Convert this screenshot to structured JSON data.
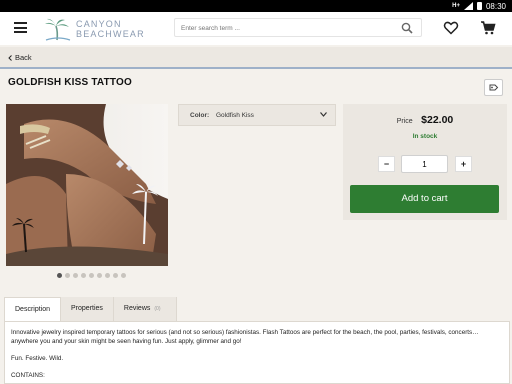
{
  "statusbar": {
    "network": "H+",
    "time": "08:30"
  },
  "header": {
    "logo_line1": "CANYON",
    "logo_line2": "BEACHWEAR",
    "search_placeholder": "Enter search term ..."
  },
  "nav": {
    "back_label": "Back"
  },
  "product": {
    "title": "GOLDFISH KISS TATTOO",
    "image_count": 9,
    "active_image": 0,
    "variant_label": "Color:",
    "variant_value": "Goldfish Kiss",
    "price_label": "Price",
    "price": "$22.00",
    "stock": "In stock",
    "quantity": "1",
    "minus": "−",
    "plus": "+",
    "add_to_cart": "Add to cart"
  },
  "tabs": [
    {
      "label": "Description",
      "active": true
    },
    {
      "label": "Properties",
      "active": false
    },
    {
      "label": "Reviews",
      "active": false,
      "count": "(0)"
    }
  ],
  "description": {
    "paragraph1": "Innovative jewelry inspired temporary tattoos for serious (and not so serious) fashionistas. Flash Tattoos are perfect for the beach, the pool, parties, festivals, concerts… anywhere you and your skin might be seen having fun. Just apply, glimmer and go!",
    "paragraph2": "Fun. Festive. Wild.",
    "paragraph3": "CONTAINS:"
  },
  "colors": {
    "accent_green": "#2e7d32",
    "stock_green": "#2e7d32",
    "divider_blue": "#9eb0c8"
  },
  "icons": [
    "menu-icon",
    "palm-tree-logo",
    "search-icon",
    "heart-icon",
    "cart-icon",
    "chevron-left-icon",
    "chevron-down-icon",
    "share-icon"
  ]
}
